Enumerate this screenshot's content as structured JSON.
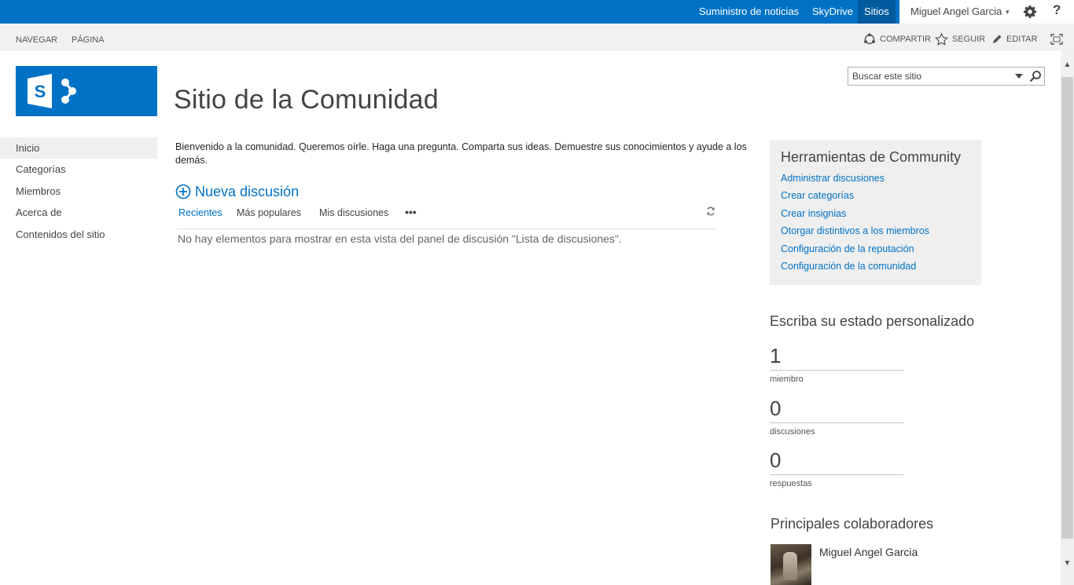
{
  "suitebar": {
    "newsfeed": "Suministro de noticias",
    "skydrive": "SkyDrive",
    "sites": "Sitios",
    "user": "Miguel Angel Garcia",
    "help": "?"
  },
  "ribbon": {
    "tabs": [
      "NAVEGAR",
      "PÁGINA"
    ],
    "share": "COMPARTIR",
    "follow": "SEGUIR",
    "edit": "EDITAR"
  },
  "search": {
    "placeholder": "Buscar este sitio"
  },
  "page_title": "Sitio de la Comunidad",
  "leftnav": {
    "items": [
      {
        "label": "Inicio",
        "selected": true
      },
      {
        "label": "Categorías"
      },
      {
        "label": "Miembros"
      },
      {
        "label": "Acerca de"
      },
      {
        "label": "Contenidos del sitio"
      }
    ]
  },
  "main": {
    "welcome": "Bienvenido a la comunidad. Queremos oírle. Haga una pregunta. Comparta sus ideas. Demuestre sus conocimientos y ayude a los demás.",
    "new_discussion": "Nueva discusión",
    "views": [
      "Recientes",
      "Más populares",
      "Mis discusiones"
    ],
    "more": "•••",
    "empty_message": "No hay elementos para mostrar en esta vista del panel de discusión \"Lista de discusiones\"."
  },
  "tools": {
    "title": "Herramientas de Community",
    "links": [
      "Administrar discusiones",
      "Crear categorías",
      "Crear insignias",
      "Otorgar distintivos a los miembros",
      "Configuración de la reputación",
      "Configuración de la comunidad"
    ]
  },
  "status": {
    "title": "Escriba su estado personalizado",
    "stats": [
      {
        "value": "1",
        "label": "miembro"
      },
      {
        "value": "0",
        "label": "discusiones"
      },
      {
        "value": "0",
        "label": "respuestas"
      }
    ]
  },
  "contributors": {
    "title": "Principales colaboradores",
    "top": {
      "name": "Miguel Angel Garcia"
    }
  },
  "colors": {
    "brand_blue": "#0072c6",
    "active_tab": "#005a9e",
    "panel_gray": "#efefef"
  }
}
